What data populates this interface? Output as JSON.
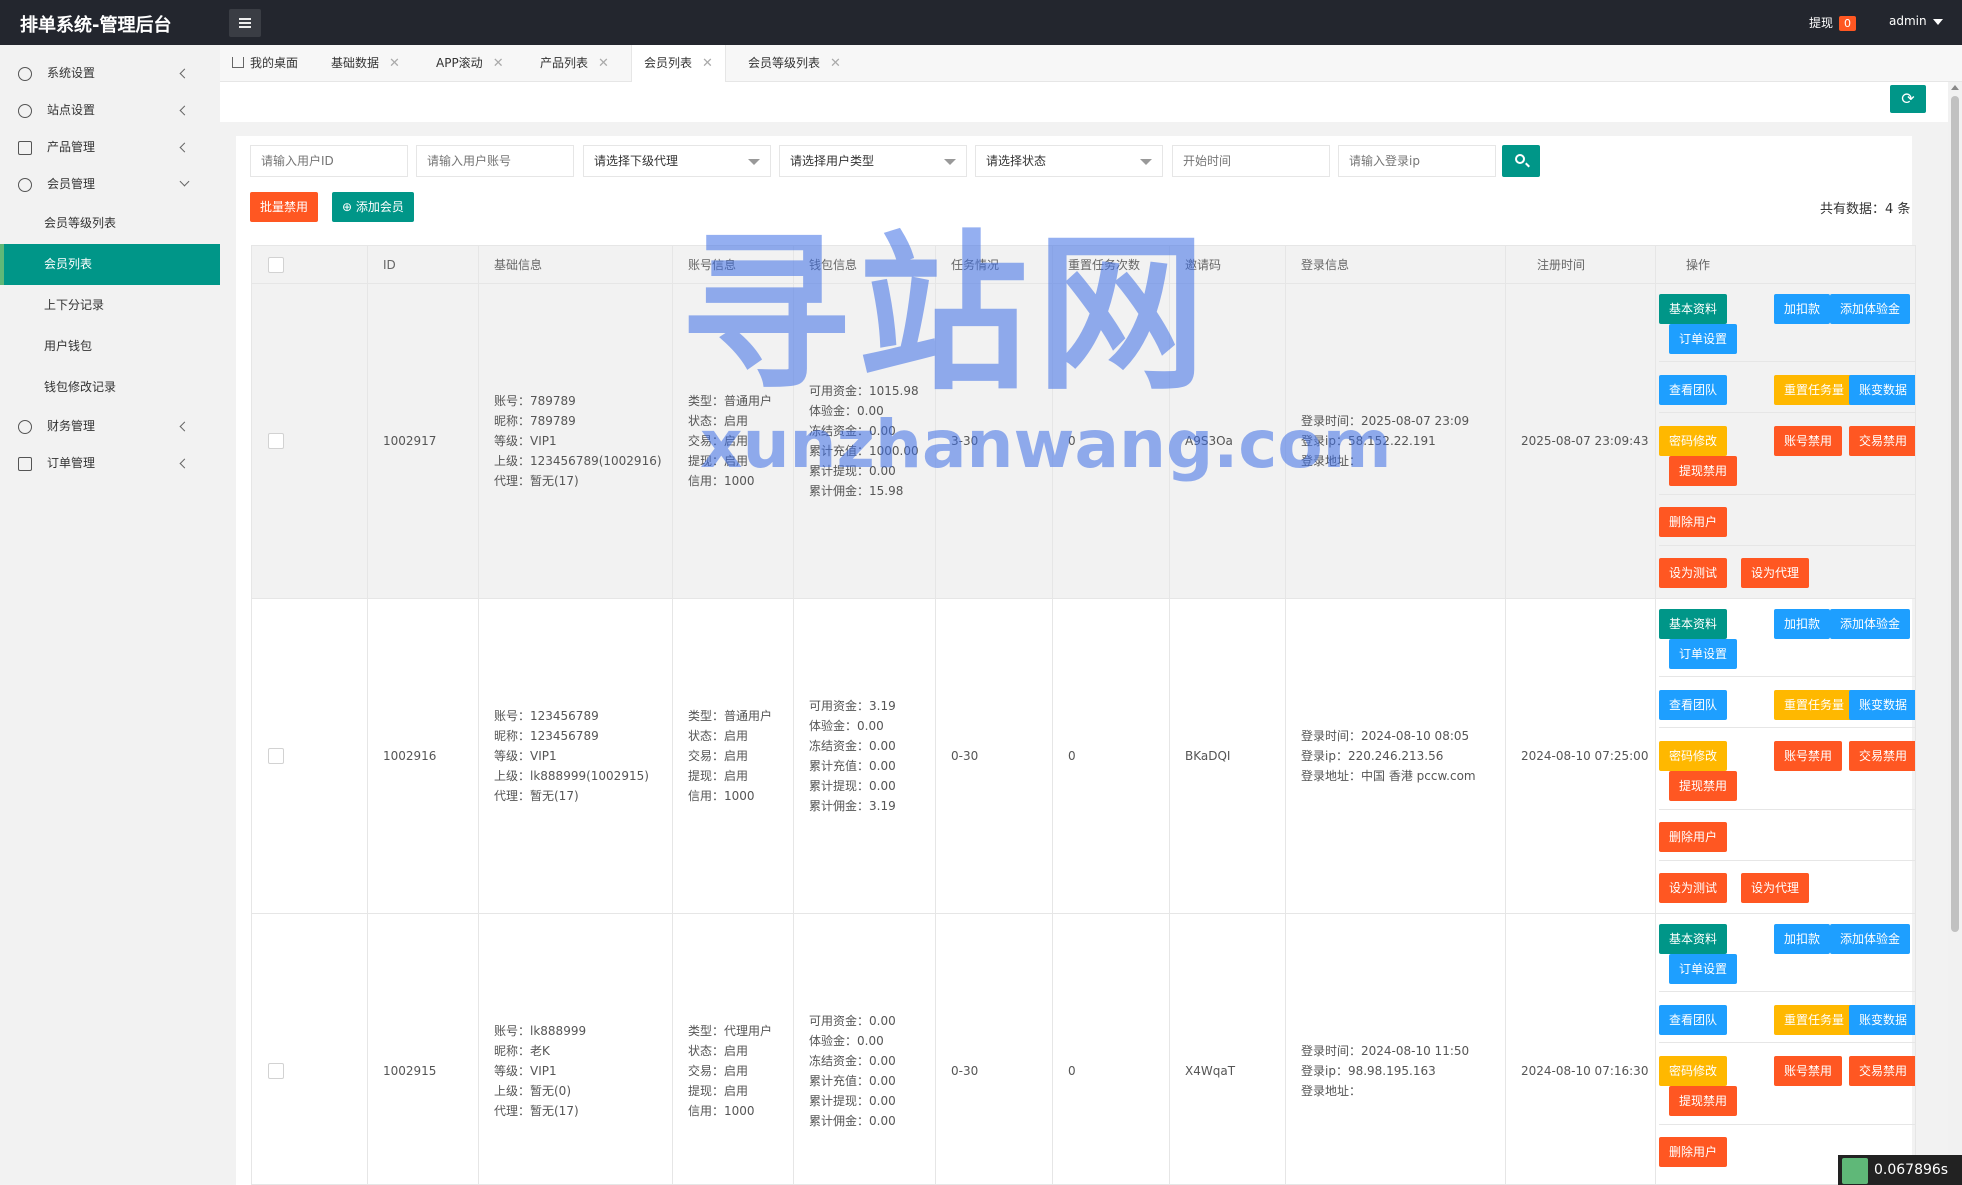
{
  "app": {
    "title": "排单系统-管理后台"
  },
  "topbar": {
    "withdraw_label": "提现",
    "withdraw_count": "0",
    "user": "admin"
  },
  "sidebar": {
    "items": [
      {
        "label": "系统设置",
        "icon": "gear-icon"
      },
      {
        "label": "站点设置",
        "icon": "site-icon"
      },
      {
        "label": "产品管理",
        "icon": "box-icon"
      },
      {
        "label": "会员管理",
        "icon": "user-icon"
      },
      {
        "label": "财务管理",
        "icon": "dollar-icon"
      },
      {
        "label": "订单管理",
        "icon": "order-icon"
      }
    ],
    "sub_items": [
      "会员等级列表",
      "会员列表",
      "上下分记录",
      "用户钱包",
      "钱包修改记录"
    ]
  },
  "tabs": [
    {
      "label": "我的桌面"
    },
    {
      "label": "基础数据"
    },
    {
      "label": "APP滚动"
    },
    {
      "label": "产品列表"
    },
    {
      "label": "会员列表"
    },
    {
      "label": "会员等级列表"
    }
  ],
  "filters": {
    "user_id_placeholder": "请输入用户ID",
    "account_placeholder": "请输入用户账号",
    "agent_select": "请选择下级代理",
    "type_select": "请选择用户类型",
    "status_select": "请选择状态",
    "start_time_placeholder": "开始时间",
    "ip_placeholder": "请输入登录ip"
  },
  "actions": {
    "batch_ban": "批量禁用",
    "add_member": "添加会员",
    "total": "共有数据：4 条"
  },
  "table": {
    "headers": [
      "ID",
      "基础信息",
      "账号信息",
      "钱包信息",
      "任务情况",
      "重置任务次数",
      "邀请码",
      "登录信息",
      "注册时间",
      "操作"
    ],
    "op_buttons": [
      "基本资料",
      "加扣款",
      "添加体验金",
      "订单设置",
      "查看团队",
      "重置任务量",
      "账变数据",
      "密码修改",
      "账号禁用",
      "交易禁用",
      "提现禁用",
      "删除用户",
      "设为测试",
      "设为代理"
    ],
    "rows": [
      {
        "id": "1002917",
        "basic": [
          "账号：789789",
          "昵称：789789",
          "等级：VIP1",
          "上级：123456789(1002916)",
          "代理：暂无(17)"
        ],
        "account": [
          "类型：普通用户",
          "状态：启用",
          "交易：启用",
          "提现：启用",
          "信用：1000"
        ],
        "wallet": [
          "可用资金：1015.98",
          "体验金：0.00",
          "冻结资金：0.00",
          "累计充值：1000.00",
          "累计提现：0.00",
          "累计佣金：15.98"
        ],
        "task": "3-30",
        "reset": "0",
        "invite": "A9S3Oa",
        "login": [
          "登录时间：2025-08-07 23:09",
          "登录ip：58.152.22.191",
          "登录地址："
        ],
        "reg_time": "2025-08-07 23:09:43"
      },
      {
        "id": "1002916",
        "basic": [
          "账号：123456789",
          "昵称：123456789",
          "等级：VIP1",
          "上级：lk888999(1002915)",
          "代理：暂无(17)"
        ],
        "account": [
          "类型：普通用户",
          "状态：启用",
          "交易：启用",
          "提现：启用",
          "信用：1000"
        ],
        "wallet": [
          "可用资金：3.19",
          "体验金：0.00",
          "冻结资金：0.00",
          "累计充值：0.00",
          "累计提现：0.00",
          "累计佣金：3.19"
        ],
        "task": "0-30",
        "reset": "0",
        "invite": "BKaDQI",
        "login": [
          "登录时间：2024-08-10 08:05",
          "登录ip：220.246.213.56",
          "登录地址：中国 香港 pccw.com"
        ],
        "reg_time": "2024-08-10 07:25:00"
      },
      {
        "id": "1002915",
        "basic": [
          "账号：lk888999",
          "昵称：老K",
          "等级：VIP1",
          "上级：暂无(0)",
          "代理：暂无(17)"
        ],
        "account": [
          "类型：代理用户",
          "状态：启用",
          "交易：启用",
          "提现：启用",
          "信用：1000"
        ],
        "wallet": [
          "可用资金：0.00",
          "体验金：0.00",
          "冻结资金：0.00",
          "累计充值：0.00",
          "累计提现：0.00",
          "累计佣金：0.00"
        ],
        "task": "0-30",
        "reset": "0",
        "invite": "X4WqaT",
        "login": [
          "登录时间：2024-08-10 11:50",
          "登录ip：98.98.195.163",
          "登录地址："
        ],
        "reg_time": "2024-08-10 07:16:30"
      }
    ]
  },
  "watermark": {
    "line1": "寻站网",
    "line2": "xunzhanwang.com"
  },
  "timer": "0.067896s",
  "colors": {
    "primary": "#009688",
    "blue": "#1e9fff",
    "orange": "#ffb800",
    "red": "#ff5722",
    "dark": "#23262e"
  }
}
